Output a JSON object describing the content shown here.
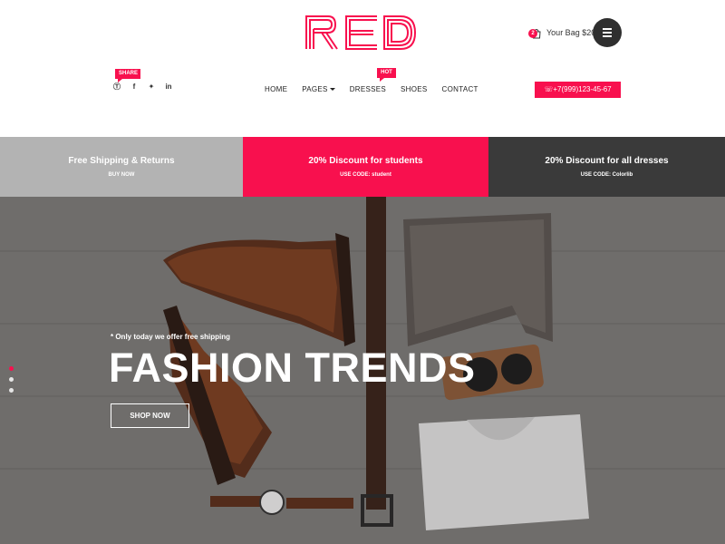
{
  "brand": {
    "logo_text": "RED",
    "accent": "#f8104e"
  },
  "header": {
    "bag_count": "2",
    "bag_label": "Your Bag $20",
    "share_tag": "SHARE",
    "hot_tag": "HOT",
    "social_icons": [
      "pinterest-icon",
      "facebook-icon",
      "twitter-icon",
      "linkedin-icon"
    ],
    "nav": [
      {
        "label": "HOME"
      },
      {
        "label": "PAGES"
      },
      {
        "label": "DRESSES"
      },
      {
        "label": "SHOES"
      },
      {
        "label": "CONTACT"
      }
    ],
    "phone": "+7(999)123-45-67"
  },
  "promos": [
    {
      "title": "Free Shipping & Returns",
      "sub": "BUY NOW",
      "color": "#b3b3b3"
    },
    {
      "title": "20% Discount for students",
      "sub": "USE CODE: student",
      "color": "#f8104e"
    },
    {
      "title": "20% Discount for all dresses",
      "sub": "USE CODE: Colorlib",
      "color": "#3a3a3a"
    }
  ],
  "hero": {
    "kicker": "* Only today we offer free shipping",
    "title": "FASHION TRENDS",
    "button": "SHOP NOW",
    "slides": 3,
    "active_slide": 1
  }
}
